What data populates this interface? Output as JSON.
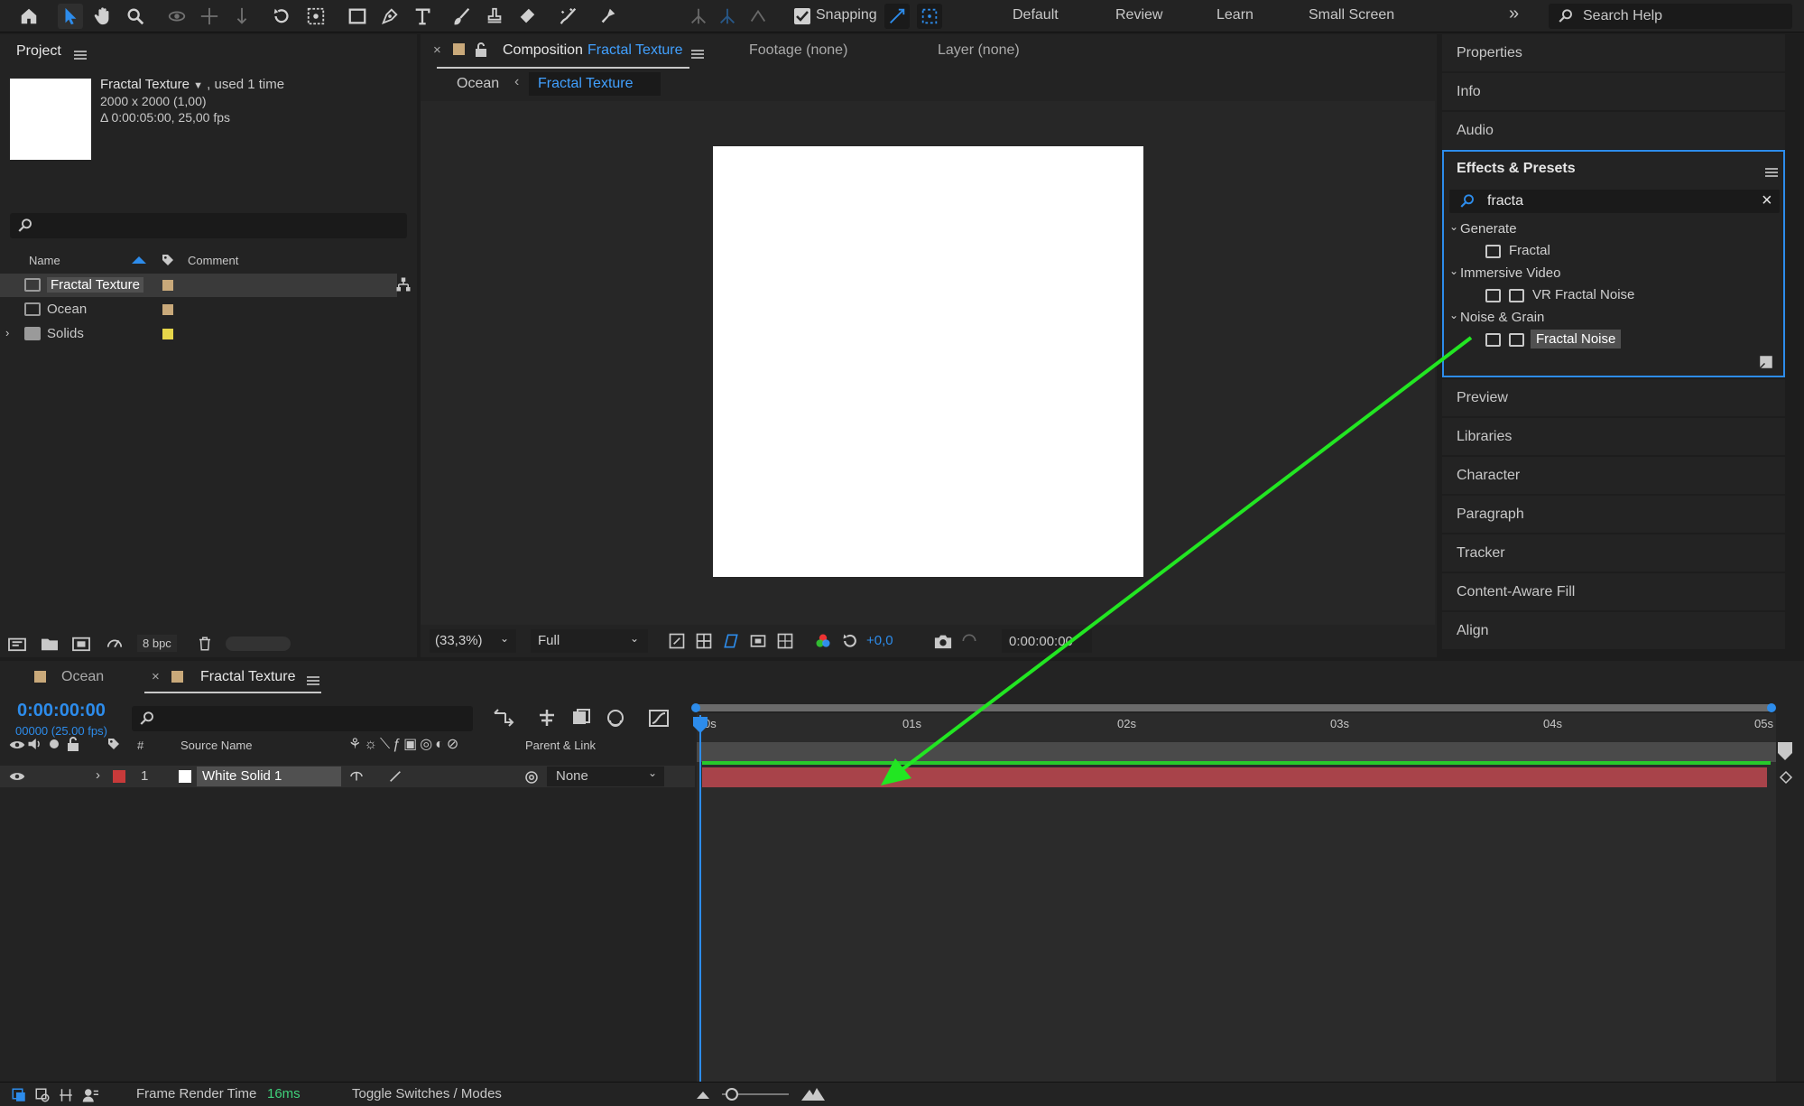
{
  "toolbar": {
    "snapping_label": "Snapping",
    "workspaces": [
      "Default",
      "Review",
      "Learn",
      "Small Screen"
    ],
    "search_placeholder": "Search Help"
  },
  "project": {
    "title": "Project",
    "item_name": "Fractal Texture",
    "item_usage": ", used 1 time",
    "item_dimensions": "2000 x 2000 (1,00)",
    "item_duration": "Δ 0:00:05:00, 25,00 fps",
    "columns": {
      "name": "Name",
      "comment": "Comment"
    },
    "items": [
      {
        "name": "Fractal Texture",
        "label_color": "#c9a97a",
        "type": "composition"
      },
      {
        "name": "Ocean",
        "label_color": "#c9a97a",
        "type": "composition"
      },
      {
        "name": "Solids",
        "label_color": "#e6d64a",
        "type": "folder"
      }
    ],
    "bit_depth": "8 bpc"
  },
  "comp": {
    "close": "×",
    "tab_prefix": "Composition",
    "tab_name": "Fractal Texture",
    "footage_tab": "Footage (none)",
    "layer_tab": "Layer (none)",
    "breadcrumb": [
      "Ocean",
      "Fractal Texture"
    ],
    "zoom": "(33,3%)",
    "resolution": "Full",
    "exposure": "+0,0",
    "timecode": "0:00:00:00"
  },
  "right_panels": {
    "top": [
      "Properties",
      "Info",
      "Audio"
    ],
    "effects_title": "Effects & Presets",
    "search_value": "fracta",
    "tree": [
      {
        "group": "Generate",
        "items": [
          "Fractal"
        ]
      },
      {
        "group": "Immersive Video",
        "items": [
          "VR Fractal Noise"
        ]
      },
      {
        "group": "Noise & Grain",
        "items": [
          "Fractal Noise"
        ]
      }
    ],
    "bottom": [
      "Preview",
      "Libraries",
      "Character",
      "Paragraph",
      "Tracker",
      "Content-Aware Fill",
      "Align"
    ]
  },
  "timeline": {
    "tabs": [
      "Ocean",
      "Fractal Texture"
    ],
    "close": "×",
    "timecode": "0:00:00:00",
    "frame_info": "00000 (25.00 fps)",
    "col_hash": "#",
    "col_source": "Source Name",
    "col_parent": "Parent & Link",
    "layer_number": "1",
    "layer_name": "White Solid 1",
    "parent_value": "None",
    "ruler": [
      "0s",
      "01s",
      "02s",
      "03s",
      "04s",
      "05s"
    ],
    "layer_color": "#c83a3a"
  },
  "status": {
    "render_label": "Frame Render Time",
    "render_value": "16ms",
    "toggle_label": "Toggle Switches / Modes"
  },
  "colors": {
    "accent": "#2d8ceb",
    "annotation_arrow": "#22e622"
  }
}
